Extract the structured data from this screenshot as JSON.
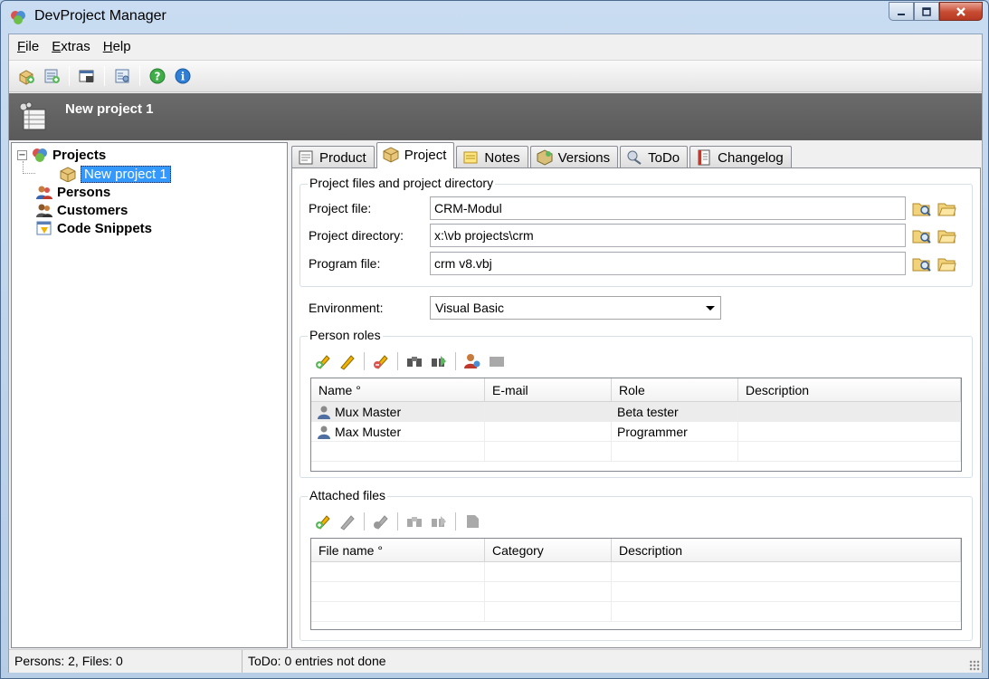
{
  "window": {
    "title": "DevProject Manager"
  },
  "menu": [
    {
      "label_u": "F",
      "label_rest": "ile"
    },
    {
      "label_u": "E",
      "label_rest": "xtras"
    },
    {
      "label_u": "H",
      "label_rest": "elp"
    }
  ],
  "toolbar_icons": [
    "new-project-icon",
    "add-item-icon",
    "report-icon",
    "settings-icon",
    "help-icon",
    "info-icon"
  ],
  "header": {
    "title": "New project 1"
  },
  "tree": {
    "projects": "Projects",
    "project_child": "New project 1",
    "persons": "Persons",
    "customers": "Customers",
    "code_snippets": "Code Snippets"
  },
  "tabs": [
    {
      "label": "Product",
      "icon": "product-icon"
    },
    {
      "label": "Project",
      "icon": "project-icon",
      "active": true
    },
    {
      "label": "Notes",
      "icon": "notes-icon"
    },
    {
      "label": "Versions",
      "icon": "versions-icon"
    },
    {
      "label": "ToDo",
      "icon": "todo-icon"
    },
    {
      "label": "Changelog",
      "icon": "changelog-icon"
    }
  ],
  "project_files": {
    "group_title": "Project files and project directory",
    "project_file_label": "Project file:",
    "project_file_value": "CRM-Modul",
    "project_directory_label": "Project directory:",
    "project_directory_value": "x:\\vb projects\\crm",
    "program_file_label": "Program file:",
    "program_file_value": "crm v8.vbj"
  },
  "environment": {
    "label": "Environment:",
    "value": "Visual Basic"
  },
  "person_roles": {
    "group_title": "Person roles",
    "columns": [
      "Name °",
      "E-mail",
      "Role",
      "Description"
    ],
    "rows": [
      {
        "name": "Mux Master",
        "email": "",
        "role": "Beta tester",
        "description": ""
      },
      {
        "name": "Max Muster",
        "email": "",
        "role": "Programmer",
        "description": ""
      }
    ]
  },
  "attached_files": {
    "group_title": "Attached files",
    "columns": [
      "File name °",
      "Category",
      "Description"
    ]
  },
  "status": {
    "left": "Persons: 2, Files: 0",
    "right": "ToDo: 0 entries not done"
  },
  "colors": {
    "selection": "#3399ff",
    "header_band": "#616161",
    "close_button": "#c74a31"
  }
}
